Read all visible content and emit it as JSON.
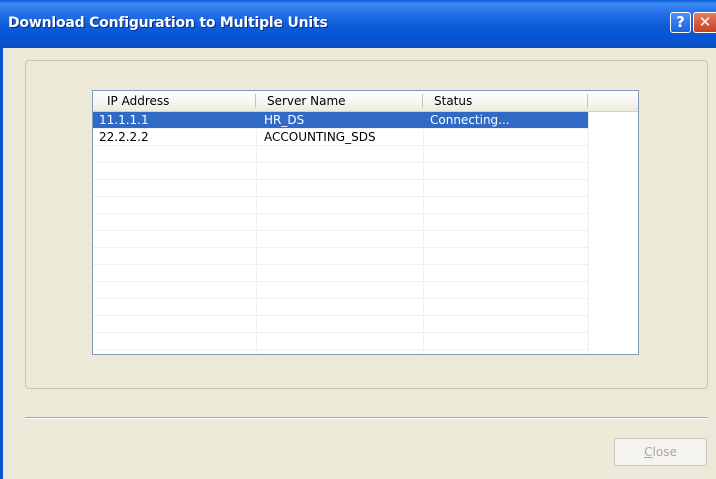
{
  "window": {
    "title": "Download Configuration to Multiple Units",
    "help_button": "?",
    "close_button": "✕"
  },
  "list": {
    "columns": [
      "IP Address",
      "Server Name",
      "Status"
    ],
    "rows": [
      {
        "ip": "11.1.1.1",
        "server": "HR_DS",
        "status": "Connecting...",
        "selected": true
      },
      {
        "ip": "22.2.2.2",
        "server": "ACCOUNTING_SDS",
        "status": "",
        "selected": false
      }
    ]
  },
  "footer": {
    "close_label": "Close"
  }
}
